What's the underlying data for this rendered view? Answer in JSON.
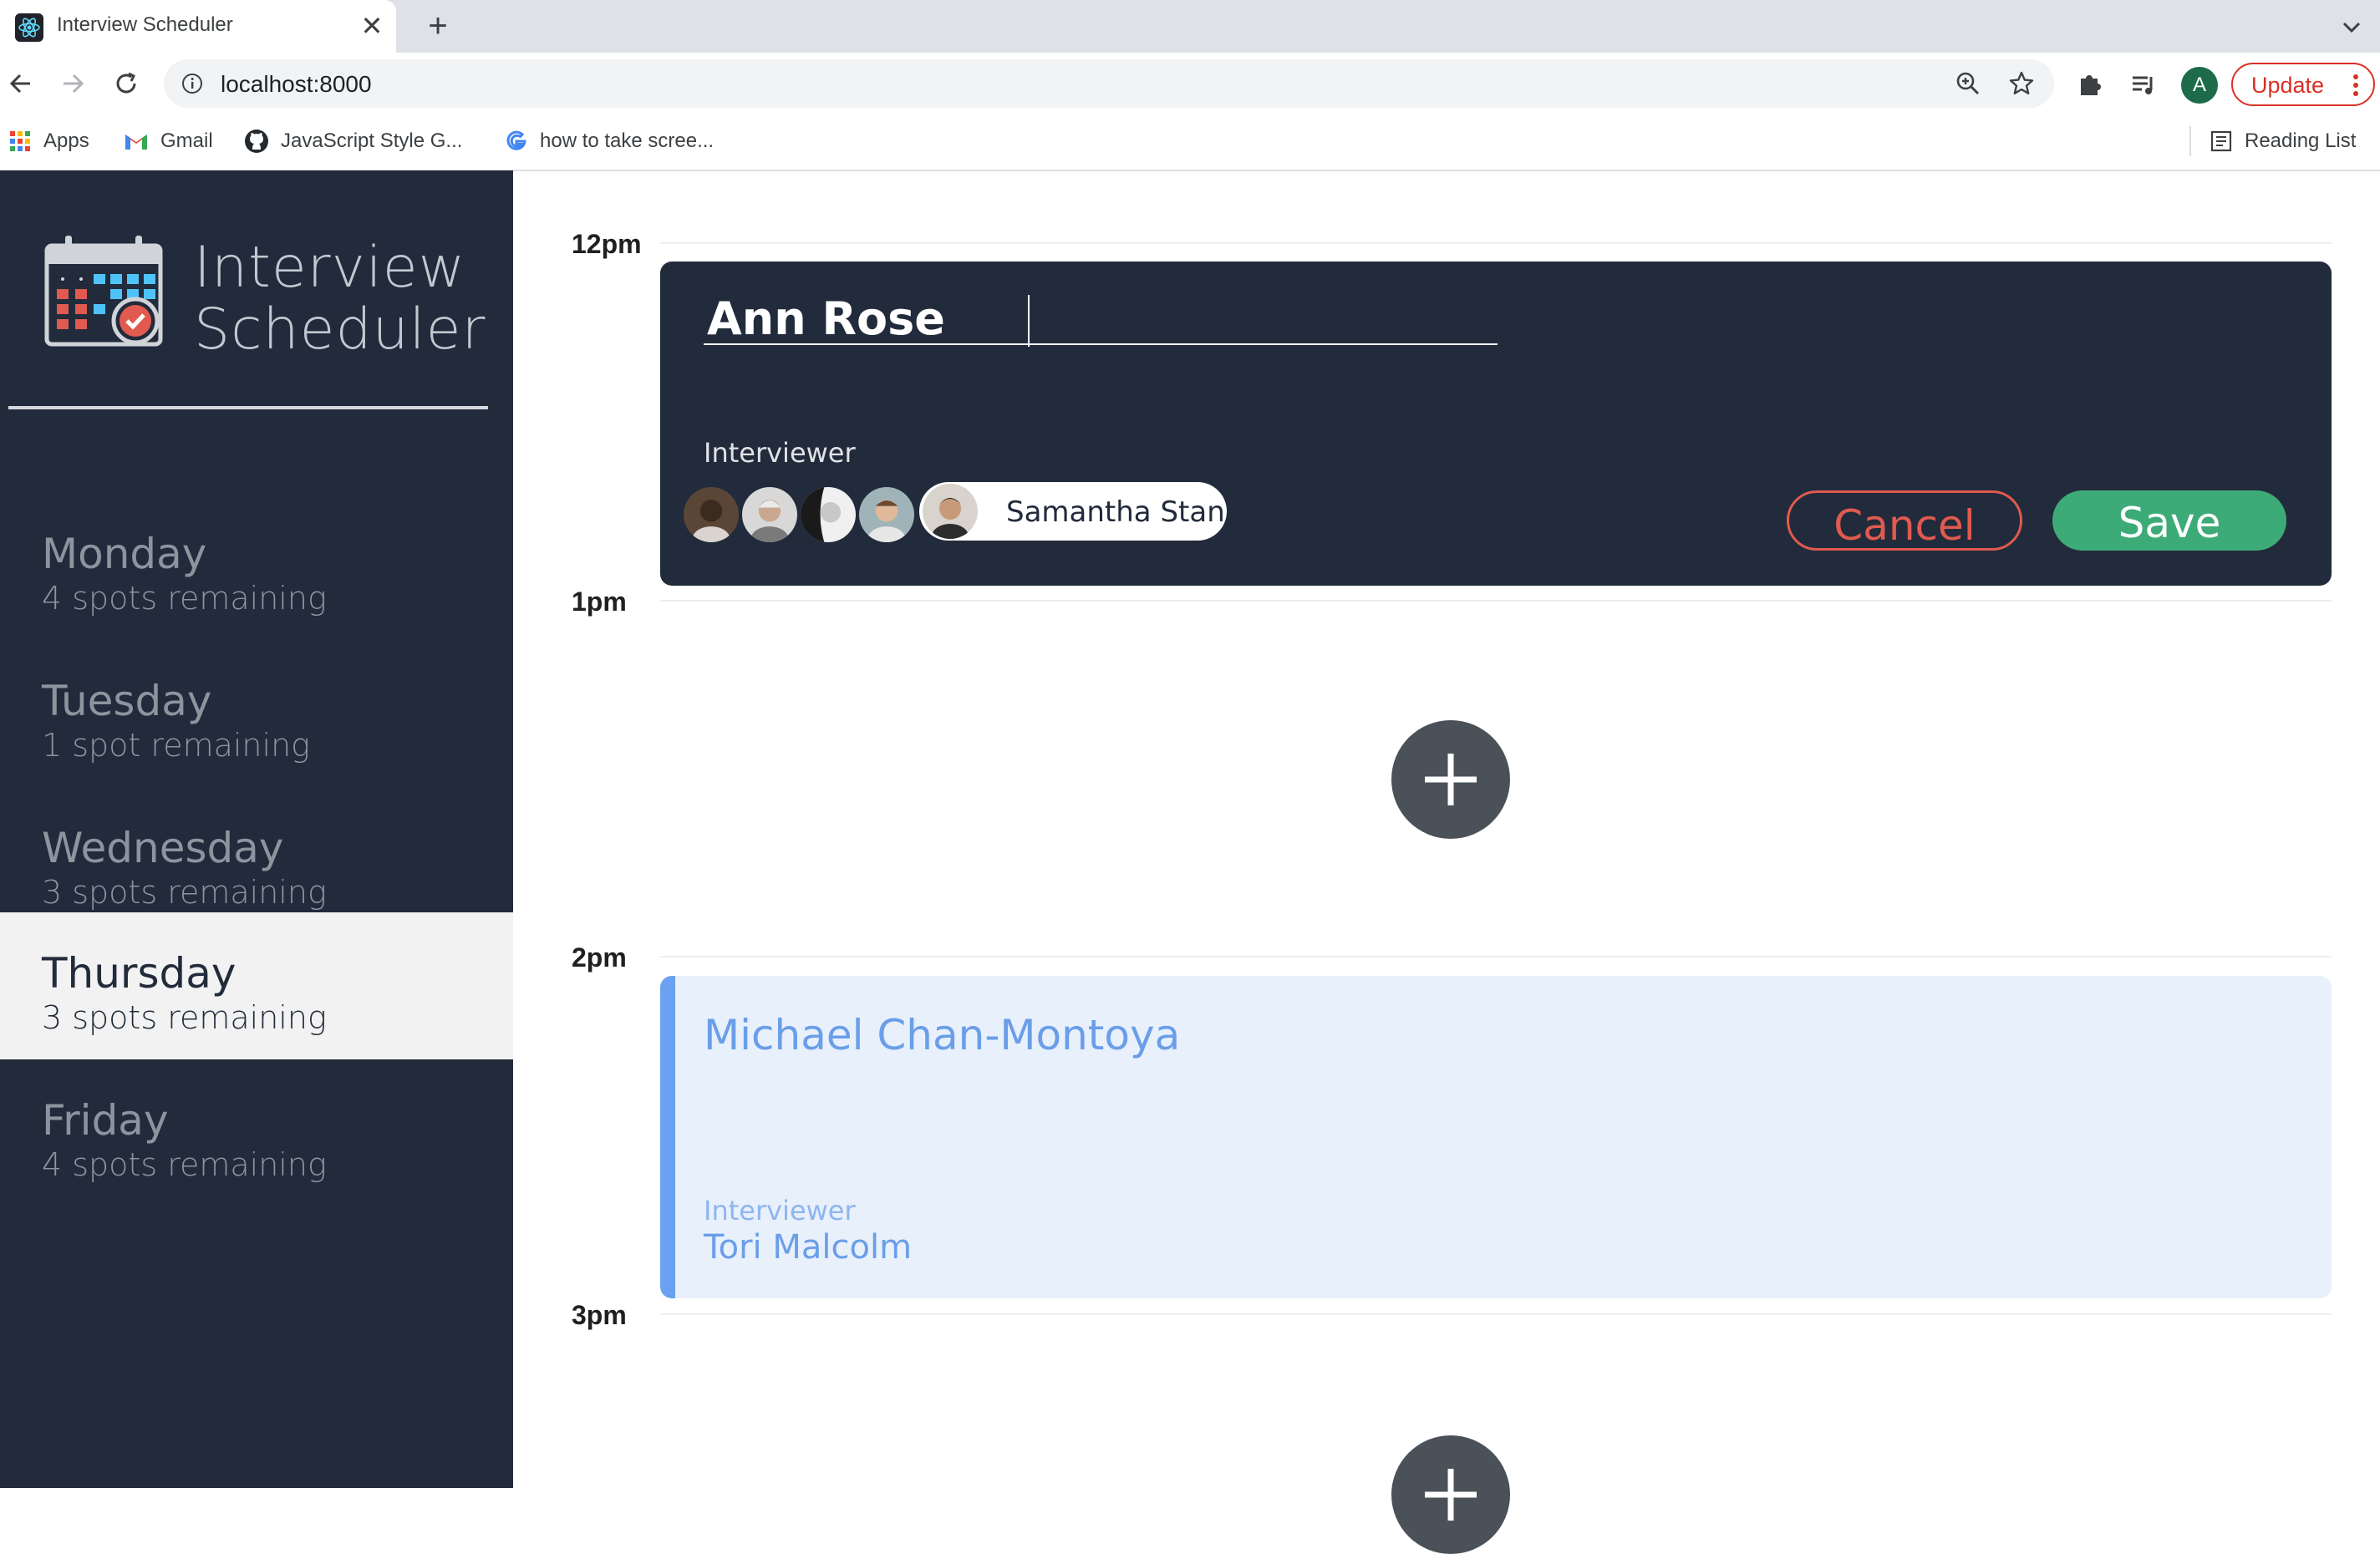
{
  "browser": {
    "tab_title": "Interview Scheduler",
    "tab_close": "✕",
    "new_tab": "+",
    "url": "localhost:8000",
    "avatar_letter": "A",
    "update_label": "Update",
    "bookmarks": [
      {
        "label": "Apps",
        "icon": "apps-grid-icon"
      },
      {
        "label": "Gmail",
        "icon": "gmail-icon"
      },
      {
        "label": "JavaScript Style G...",
        "icon": "github-icon"
      },
      {
        "label": "how to take scree...",
        "icon": "google-icon"
      }
    ],
    "reading_list": "Reading List"
  },
  "sidebar": {
    "title_line1": "Interview",
    "title_line2": "Scheduler",
    "days": [
      {
        "name": "Monday",
        "spots": "4 spots remaining",
        "selected": false
      },
      {
        "name": "Tuesday",
        "spots": "1 spot remaining",
        "selected": false
      },
      {
        "name": "Wednesday",
        "spots": "3 spots remaining",
        "selected": false
      },
      {
        "name": "Thursday",
        "spots": "3 spots remaining",
        "selected": true
      },
      {
        "name": "Friday",
        "spots": "4 spots remaining",
        "selected": false
      }
    ]
  },
  "schedule": {
    "hours": [
      "12pm",
      "1pm",
      "2pm",
      "3pm"
    ],
    "form": {
      "student_name": "Ann Rose",
      "interviewer_label": "Interviewer",
      "selected_interviewer": "Samantha Stanic",
      "cancel_label": "Cancel",
      "save_label": "Save"
    },
    "appointment": {
      "student": "Michael Chan-Montoya",
      "interviewer_label": "Interviewer",
      "interviewer": "Tori Malcolm"
    }
  },
  "colors": {
    "sidebar_bg": "#222b3b",
    "save": "#3dab78",
    "cancel": "#e05a4f",
    "appointment_accent": "#6aa1f0"
  }
}
